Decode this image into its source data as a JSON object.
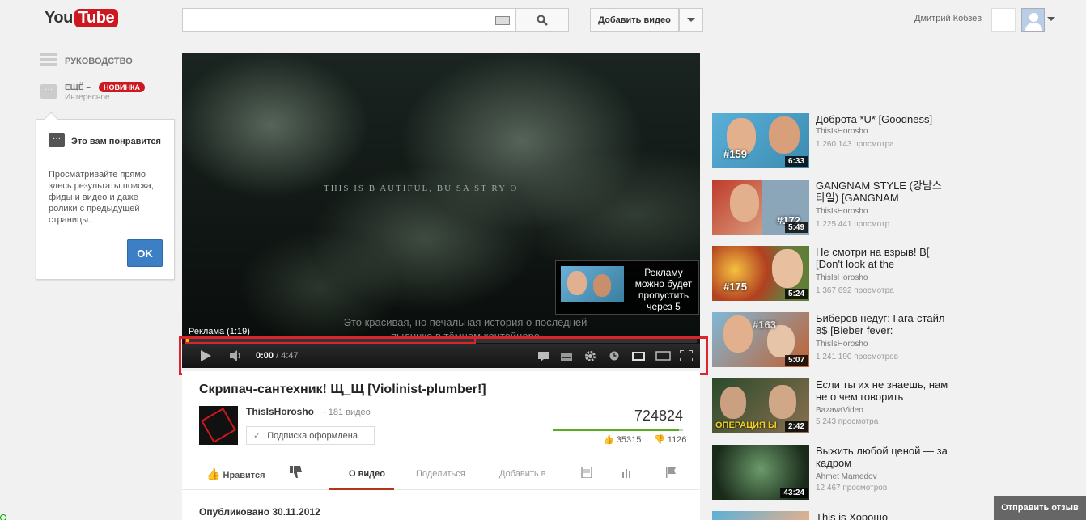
{
  "header": {
    "logo_you": "You",
    "logo_tube": "Tube",
    "search_placeholder": "",
    "add_video_label": "Добавить видео",
    "username": "Дмитрий Кобзев"
  },
  "guide": {
    "guide_label": "РУКОВОДСТВО",
    "more_label": "ЕЩЁ –",
    "new_badge": "НОВИНКА",
    "more_sub": "Интересное",
    "popup_title": "Это вам понравится",
    "popup_text": "Просматривайте прямо здесь результаты поиска, фиды и видео и даже ролики с предыдущей страницы.",
    "ok_label": "OK"
  },
  "player": {
    "overlay_text": "THIS IS   B  AUTIFUL, BU  SA  ST  RY O",
    "subtitle_line1": "Это красивая, но печальная история о последней",
    "subtitle_line2": "пылинке в тёмном контейнере",
    "ad_skip_text": "Рекламу можно будет пропустить через 5",
    "ad_label": "Реклама (1:19)",
    "current_time": "0:00",
    "duration": "/ 4:47",
    "progress": 0.007
  },
  "video": {
    "title": "Скрипач-сантехник! Щ_Щ [Violinist-plumber!]",
    "channel_name": "ThisIsHorosho",
    "channel_count": "· 181 видео",
    "subscribed_label": "Подписка оформлена",
    "views": "724824",
    "likes": "35315",
    "dislikes": "1126",
    "like_ratio": 0.969,
    "like_label": "Нравится",
    "tab_about": "О видео",
    "tab_share": "Поделиться",
    "tab_add": "Добавить в",
    "published": "Опубликовано 30.11.2012"
  },
  "related": [
    {
      "title": "Доброта *U* [Goodness]",
      "author": "ThisIsHorosho",
      "views": "1 260 143 просмотра",
      "duration": "6:33",
      "num": "#159"
    },
    {
      "title": "GANGNAM STYLE (강남스타일) [GANGNAM",
      "author": "ThisIsHorosho",
      "views": "1 225 441 просмотр",
      "duration": "5:49",
      "num": "#172"
    },
    {
      "title": "Не смотри на взрыв! В[ [Don't look at the",
      "author": "ThisIsHorosho",
      "views": "1 367 692 просмотра",
      "duration": "5:24",
      "num": "#175"
    },
    {
      "title": "Биберов недуг: Гага-стайл 8$ [Bieber fever:",
      "author": "ThisIsHorosho",
      "views": "1 241 190 просмотров",
      "duration": "5:07",
      "num": "#163"
    },
    {
      "title": "Если ты их не знаешь, нам не о чем говорить",
      "author": "BazavaVideo",
      "views": "5 243 просмотра",
      "duration": "2:42",
      "num": "ОПЕРАЦИЯ Ы"
    },
    {
      "title": "Выжить любой ценой — за кадром",
      "author": "Ahmet Mamedov",
      "views": "12 467 просмотров",
      "duration": "43:24",
      "num": ""
    },
    {
      "title": "This is Хорошо -",
      "author": "",
      "views": "",
      "duration": "",
      "num": ""
    }
  ],
  "feedback_label": "Отправить отзыв"
}
